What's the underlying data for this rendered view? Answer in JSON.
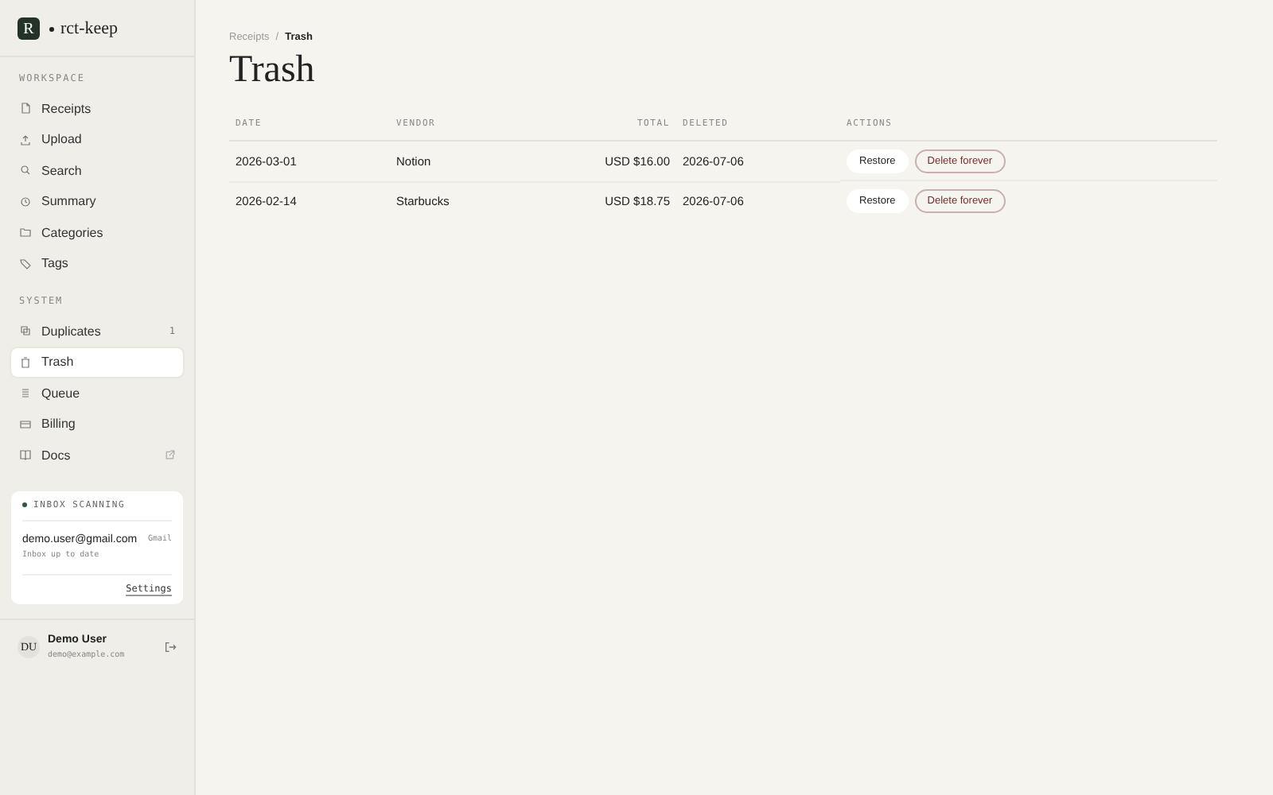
{
  "brand": {
    "mark": "R",
    "name": "rct-keep"
  },
  "sections": [
    {
      "title": "WORKSPACE",
      "items": [
        {
          "label": "Receipts",
          "selected": false
        },
        {
          "label": "Upload",
          "selected": false
        },
        {
          "label": "Search",
          "selected": false
        },
        {
          "label": "Summary",
          "selected": false
        },
        {
          "label": "Categories",
          "selected": false
        },
        {
          "label": "Tags",
          "selected": false
        }
      ]
    },
    {
      "title": "SYSTEM",
      "items": [
        {
          "label": "Duplicates",
          "selected": false,
          "badge": "1"
        },
        {
          "label": "Trash",
          "selected": true
        },
        {
          "label": "Queue",
          "selected": false
        },
        {
          "label": "Billing",
          "selected": false
        },
        {
          "label": "Docs",
          "selected": false,
          "external": true
        }
      ]
    }
  ],
  "inbox": {
    "title": "INBOX SCANNING",
    "email": "demo.user@gmail.com",
    "provider": "Gmail",
    "status": "Inbox up to date",
    "settings": "Settings"
  },
  "user": {
    "initials": "DU",
    "name": "Demo User",
    "email": "demo@example.com"
  },
  "breadcrumb": [
    "Receipts",
    "Trash"
  ],
  "breadcrumb_separator": "/",
  "title": "Trash",
  "table": {
    "columns": [
      "DATE",
      "VENDOR",
      "TOTAL",
      "DELETED",
      "ACTIONS"
    ],
    "rows": [
      {
        "date": "2026-03-01",
        "vendor": "Notion",
        "total": "USD $16.00",
        "deleted": "2026-07-06",
        "restore": "Restore",
        "delete": "Delete forever"
      },
      {
        "date": "2026-02-14",
        "vendor": "Starbucks",
        "total": "USD $18.75",
        "deleted": "2026-07-06",
        "restore": "Restore",
        "delete": "Delete forever"
      }
    ]
  }
}
